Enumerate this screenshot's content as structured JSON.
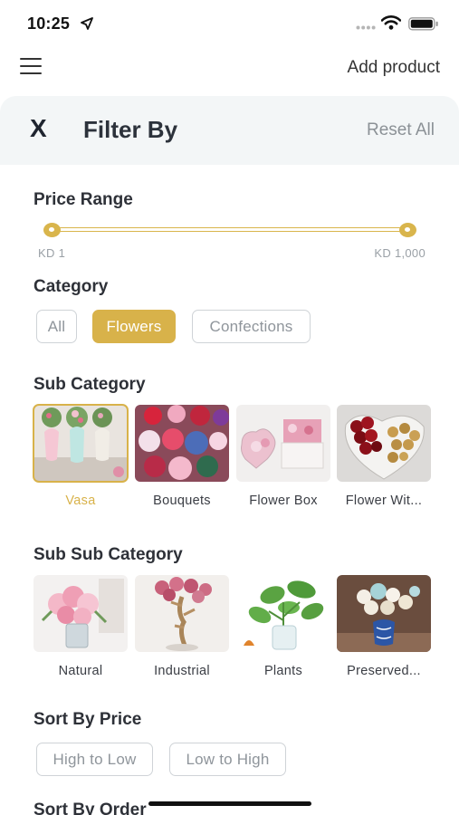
{
  "status": {
    "time": "10:25"
  },
  "header": {
    "add_product_label": "Add product"
  },
  "filter": {
    "title": "Filter By",
    "close_label": "X",
    "reset_label": "Reset All"
  },
  "price": {
    "title": "Price Range",
    "min_label": "KD 1",
    "max_label": "KD 1,000"
  },
  "category": {
    "title": "Category",
    "chips": [
      {
        "label": "All",
        "active": false
      },
      {
        "label": "Flowers",
        "active": true
      },
      {
        "label": "Confections",
        "active": false
      }
    ]
  },
  "sub_category": {
    "title": "Sub Category",
    "items": [
      {
        "label": "Vasa",
        "selected": true
      },
      {
        "label": "Bouquets",
        "selected": false
      },
      {
        "label": "Flower Box",
        "selected": false
      },
      {
        "label": "Flower Wit...",
        "selected": false
      }
    ]
  },
  "sub_sub_category": {
    "title": "Sub Sub Category",
    "items": [
      {
        "label": "Natural"
      },
      {
        "label": "Industrial"
      },
      {
        "label": "Plants"
      },
      {
        "label": "Preserved..."
      }
    ]
  },
  "sort_price": {
    "title": "Sort By Price",
    "options": [
      {
        "label": "High to Low"
      },
      {
        "label": "Low to High"
      }
    ]
  },
  "sort_order": {
    "title": "Sort By Order"
  },
  "colors": {
    "accent": "#d8b24a",
    "header_bg": "#f3f6f7",
    "muted": "#8f959b"
  }
}
